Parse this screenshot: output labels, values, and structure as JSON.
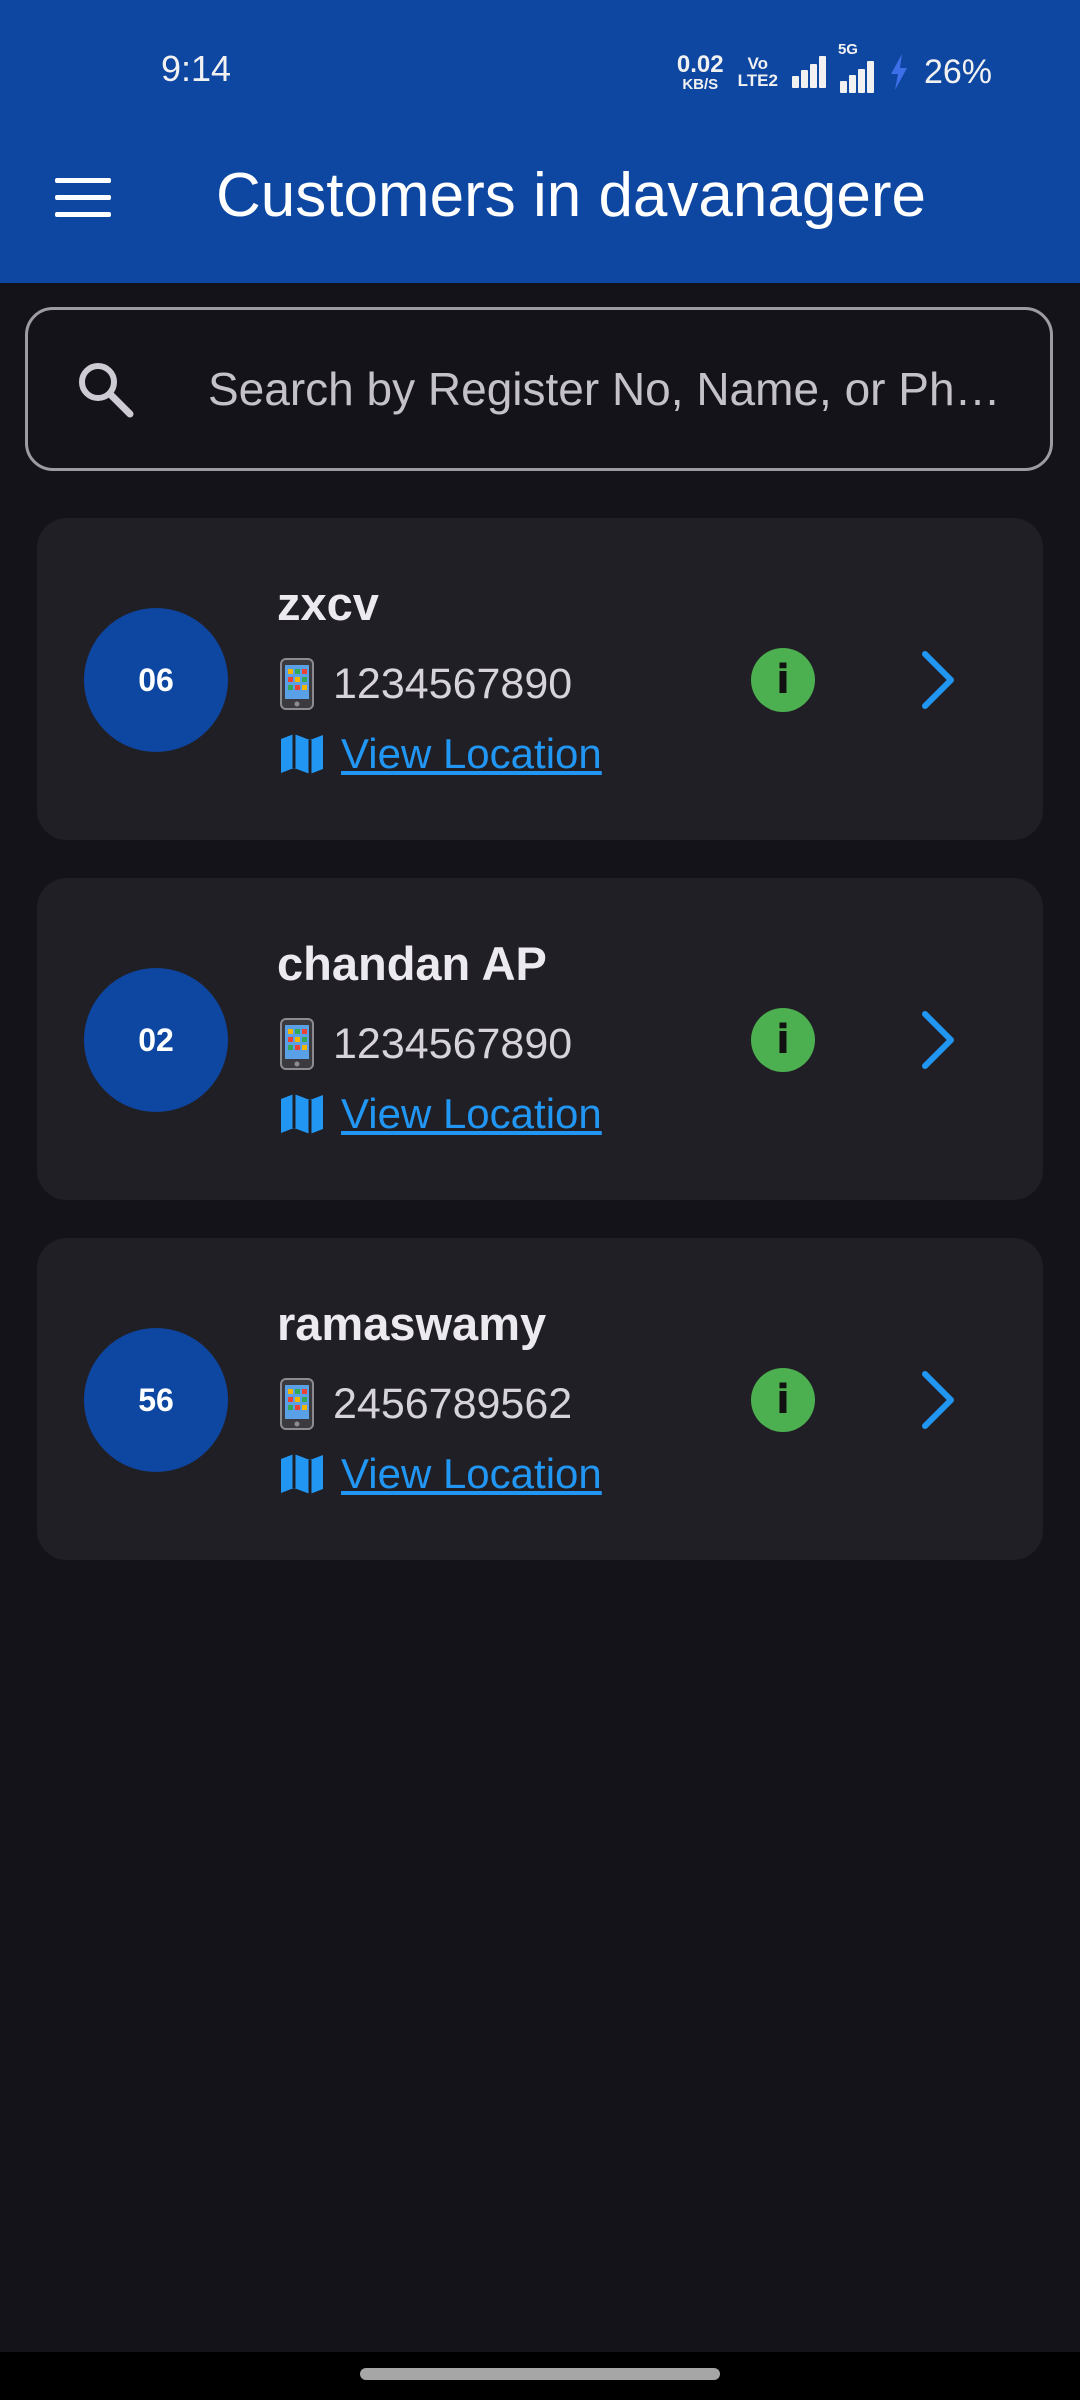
{
  "status_bar": {
    "time": "9:14",
    "net_speed_value": "0.02",
    "net_speed_unit": "KB/S",
    "volte_top": "Vo",
    "volte_bottom": "LTE2",
    "network_5g": "5G",
    "battery": "26%"
  },
  "app_bar": {
    "title": "Customers in davanagere",
    "menu_icon": "hamburger-menu-icon"
  },
  "search": {
    "placeholder": "Search by Register No, Name, or Phone",
    "value": "",
    "icon": "search-icon"
  },
  "customers": [
    {
      "register_no": "06",
      "name": "zxcv",
      "phone": "1234567890",
      "location_label": "View Location"
    },
    {
      "register_no": "02",
      "name": "chandan AP",
      "phone": "1234567890",
      "location_label": "View Location"
    },
    {
      "register_no": "56",
      "name": "ramaswamy",
      "phone": "2456789562",
      "location_label": "View Location"
    }
  ],
  "colors": {
    "app_bar": "#0d47a1",
    "background": "#15131a",
    "card": "#211f26",
    "link": "#2196f3",
    "info": "#4caf50",
    "avatar": "#0d47a1"
  }
}
